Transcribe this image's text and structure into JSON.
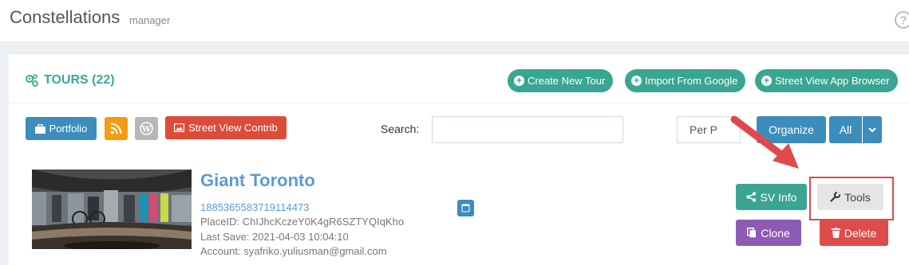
{
  "header": {
    "title": "Constellations",
    "subtitle": "manager",
    "help_icon": "?"
  },
  "tours_box": {
    "title": "TOURS (22)",
    "actions": {
      "create": "Create New Tour",
      "import": "Import From Google",
      "browser": "Street View App Browser"
    }
  },
  "toolbar": {
    "portfolio": "Portfolio",
    "street_view_contrib": "Street View Contrib",
    "search_label": "Search:",
    "search_value": "",
    "per_page": "Per P",
    "organize": "Organize",
    "all": "All"
  },
  "tour": {
    "name": "Giant Toronto",
    "id": "1885365583719114473",
    "place_id": "PlaceID: ChIJhcKczeY0K4gR6SZTYQIqKho",
    "last_save": "Last Save: 2021-04-03 10:04:10",
    "account": "Account: syafriko.yuliusman@gmail.com",
    "buttons": {
      "sv_info": "SV Info",
      "tools": "Tools",
      "clone": "Clone",
      "delete": "Delete"
    }
  },
  "colors": {
    "teal": "#39a592",
    "blue": "#3c8dbc",
    "orange": "#f39c12",
    "gray": "#b7b7b7",
    "red": "#dd4b39",
    "purple": "#8e5bb4",
    "annotation_red": "#e0484e"
  }
}
